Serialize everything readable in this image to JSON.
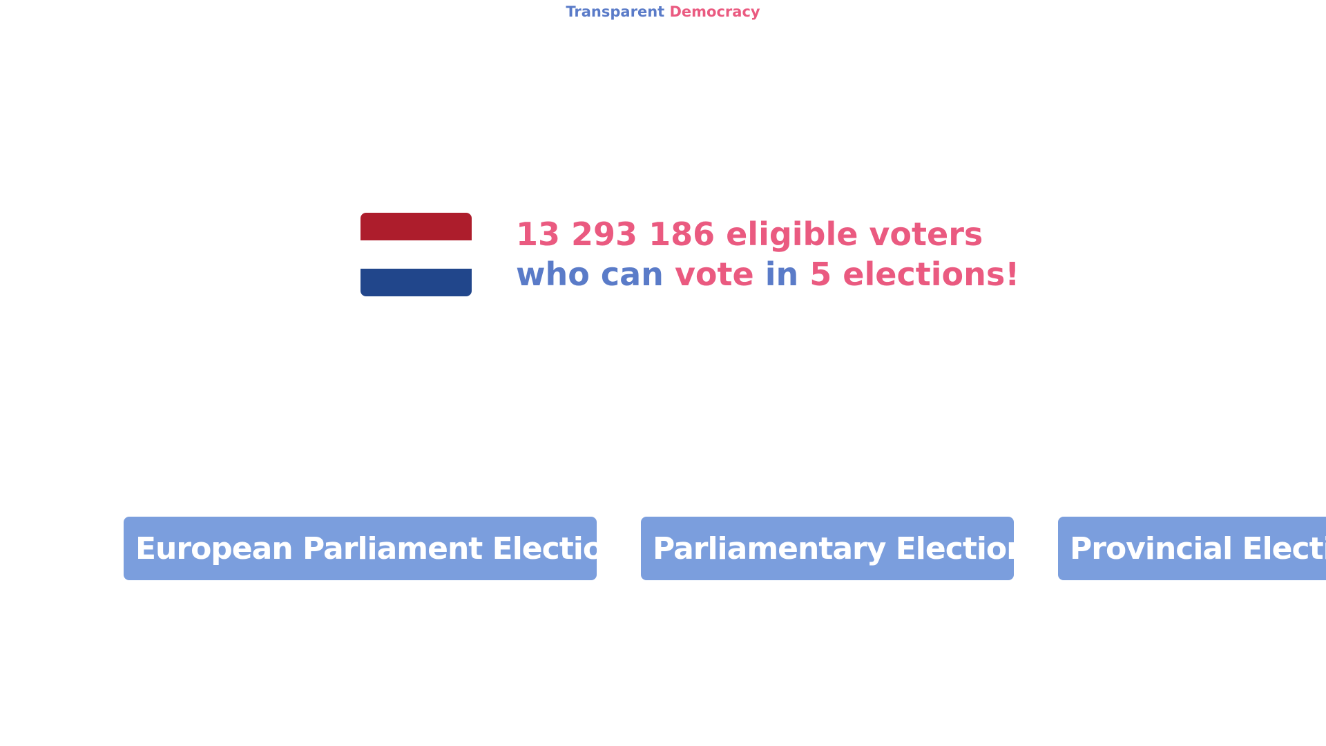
{
  "brand": {
    "word1": "Transparent",
    "word2": "Democracy"
  },
  "hero": {
    "flag": "netherlands-flag",
    "line1": "13 293 186 eligible voters",
    "line2_part1": "who can ",
    "line2_part2": "vote ",
    "line2_part3": "in ",
    "line2_part4": "5 elections!"
  },
  "elections": [
    {
      "label": "European Parliament Elections"
    },
    {
      "label": "Parliamentary Elections"
    },
    {
      "label": "Provincial Elections"
    }
  ],
  "colors": {
    "brand_blue": "#5a7bc8",
    "brand_pink": "#ea5a80",
    "button_bg": "#7b9edd",
    "flag_red": "#ad1d2c",
    "flag_white": "#ffffff",
    "flag_blue": "#21468b"
  }
}
